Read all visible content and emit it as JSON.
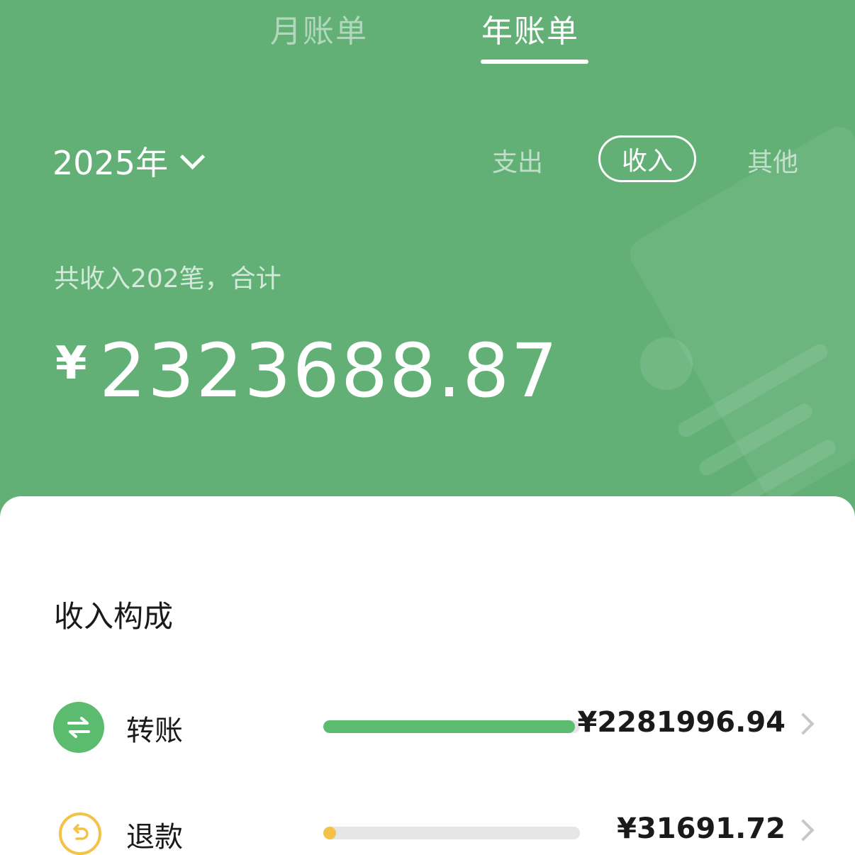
{
  "tabs": {
    "month": "月账单",
    "year": "年账单",
    "active": "year"
  },
  "year_selector": {
    "value": "2025年",
    "icon": "chevron-down-icon"
  },
  "filters": {
    "expense": "支出",
    "income": "收入",
    "other": "其他",
    "selected": "income"
  },
  "summary": {
    "line": "共收入202笔，合计",
    "currency": "¥",
    "amount": "2323688.87"
  },
  "composition": {
    "title": "收入构成",
    "items": [
      {
        "label": "转账",
        "amount": "¥2281996.94",
        "fraction": 0.982,
        "color": "#5bbb6e",
        "icon": "transfer-arrows-icon"
      },
      {
        "label": "退款",
        "amount": "¥31691.72",
        "fraction": 0.05,
        "color": "#f4c247",
        "icon": "refund-return-icon"
      }
    ]
  },
  "colors": {
    "header_green": "#62b076",
    "accent_green": "#5bbb6e",
    "refund_yellow": "#f4c247"
  }
}
